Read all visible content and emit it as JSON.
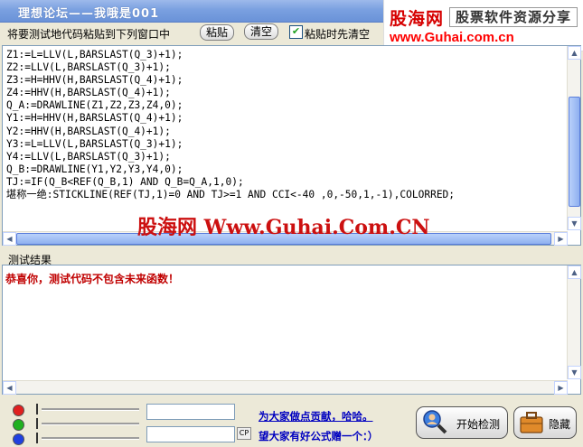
{
  "window": {
    "title": "理想论坛——我哦是001"
  },
  "watermark": {
    "brand": "股海网",
    "slogan": "股票软件资源分享",
    "url": "www.Guhai.com.cn",
    "center": "股海网 Www.Guhai.Com.CN"
  },
  "toolbar": {
    "instruction": "将要测试地代码粘贴到下列窗口中",
    "paste_label": "粘贴",
    "clear_label": "清空",
    "auto_clear_checked": true,
    "auto_clear_label": "粘贴时先清空"
  },
  "editor": {
    "lines": [
      "Z1:=L=LLV(L,BARSLAST(Q_3)+1);",
      "Z2:=LLV(L,BARSLAST(Q_3)+1);",
      "Z3:=H=HHV(H,BARSLAST(Q_4)+1);",
      "Z4:=HHV(H,BARSLAST(Q_4)+1);",
      "Q_A:=DRAWLINE(Z1,Z2,Z3,Z4,0);",
      "Y1:=H=HHV(H,BARSLAST(Q_4)+1);",
      "Y2:=HHV(H,BARSLAST(Q_4)+1);",
      "Y3:=L=LLV(L,BARSLAST(Q_3)+1);",
      "Y4:=LLV(L,BARSLAST(Q_3)+1);",
      "Q_B:=DRAWLINE(Y1,Y2,Y3,Y4,0);",
      "TJ:=IF(Q_B<REF(Q_B,1) AND Q_B=Q_A,1,0);",
      "堪称一绝:STICKLINE(REF(TJ,1)=0 AND TJ>=1 AND CCI<-40 ,0,-50,1,-1),COLORRED;"
    ]
  },
  "results": {
    "label": "测试结果",
    "message": "恭喜你，测试代码不包含未来函数！"
  },
  "bottom": {
    "lights": [
      "#e02020",
      "#20b020",
      "#2040e0"
    ],
    "cp_label": "CP",
    "msg1": "为大家做点贡献，哈哈。",
    "msg2": "望大家有好公式赠一个：）",
    "start_label": "开始检测",
    "hide_label": "隐藏"
  }
}
